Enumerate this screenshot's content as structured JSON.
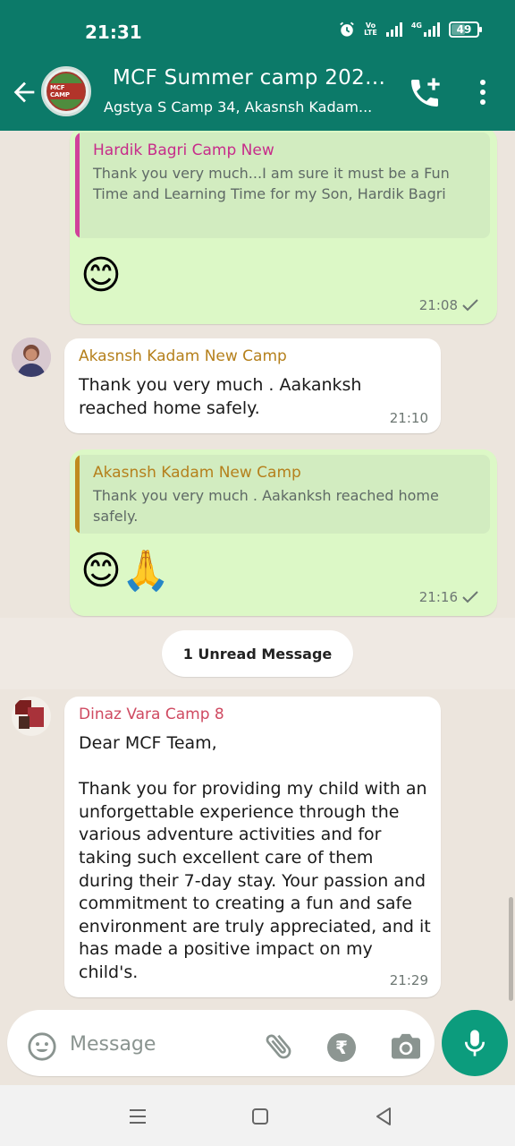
{
  "status_bar": {
    "time": "21:31",
    "vo_label": "Vo",
    "lte_label": "LTE",
    "net_4g": "4G",
    "battery": "49"
  },
  "header": {
    "title": "MCF Summer camp 2023...",
    "subtitle": "Agstya S Camp 34, Akasnsh Kadam...",
    "avatar_text": "MCF CAMP"
  },
  "messages": [
    {
      "direction": "outgoing",
      "quote_name": "Hardik Bagri Camp New",
      "quote_text": "Thank you very much...I am sure it must be a Fun Time and Learning Time for my Son, Hardik Bagri",
      "emoji": "😊",
      "time": "21:08"
    },
    {
      "direction": "incoming",
      "sender": "Akasnsh Kadam New Camp",
      "text": "Thank you very much . Aakanksh reached home safely.",
      "time": "21:10"
    },
    {
      "direction": "outgoing",
      "quote_name": "Akasnsh Kadam New Camp",
      "quote_text": "Thank you very much . Aakanksh reached home safely.",
      "emoji": "😊🙏",
      "time": "21:16"
    },
    {
      "direction": "incoming",
      "sender": "Dinaz Vara Camp 8",
      "text": "Dear MCF Team,\n\nThank you for providing my child with an unforgettable experience through the various adventure activities and for taking such excellent care of them during their 7-day stay. Your passion and commitment to creating a fun and safe environment are truly appreciated, and it has made a positive impact on my child's.",
      "time": "21:29"
    }
  ],
  "unread_label": "1 Unread Message",
  "composer": {
    "placeholder": "Message",
    "value": ""
  },
  "colors": {
    "header": "#0c7a69",
    "outgoing_bubble": "#dcf8c6",
    "incoming_bubble": "#ffffff",
    "mic_button": "#0c9c7d",
    "chat_background": "#ece5dd"
  },
  "icons": [
    "back-arrow-icon",
    "add-call-icon",
    "more-vert-icon",
    "emoji-icon",
    "attach-icon",
    "rupee-icon",
    "camera-icon",
    "mic-icon",
    "read-check-icon",
    "alarm-icon",
    "signal-icon",
    "battery-icon",
    "nav-recents-icon",
    "nav-home-icon",
    "nav-back-icon"
  ]
}
